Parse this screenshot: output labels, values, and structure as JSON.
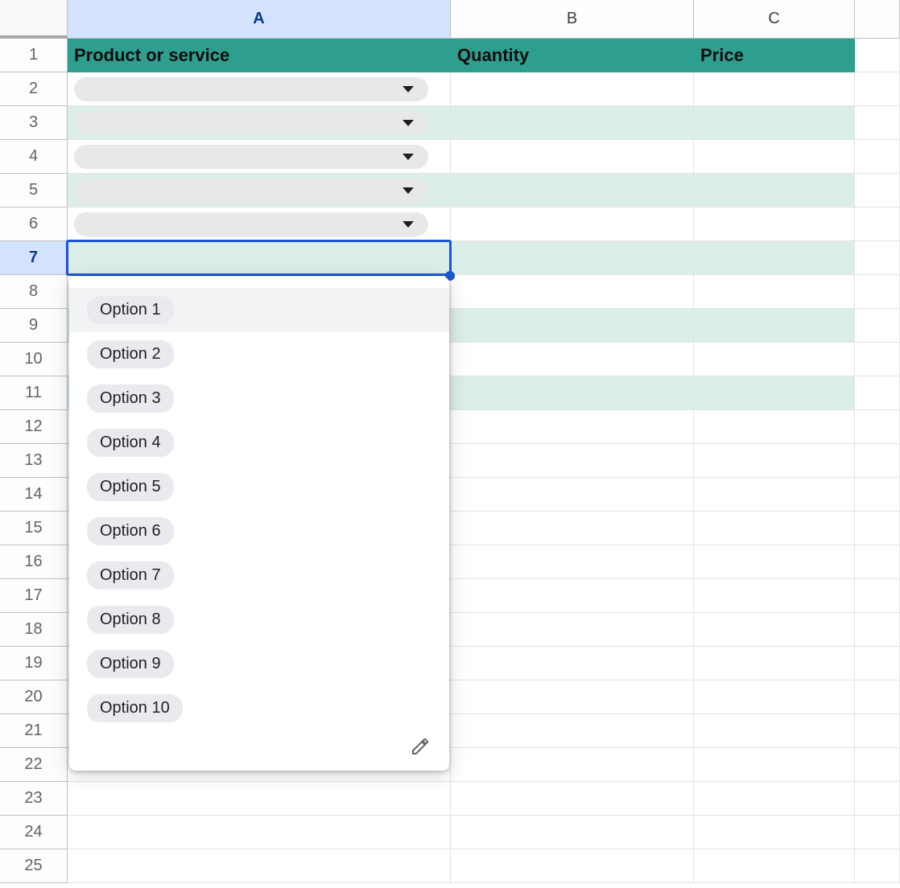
{
  "columns": {
    "a": "A",
    "b": "B",
    "c": "C"
  },
  "rows": [
    "1",
    "2",
    "3",
    "4",
    "5",
    "6",
    "7",
    "8",
    "9",
    "10",
    "11",
    "12",
    "13",
    "14",
    "15",
    "16",
    "17",
    "18",
    "19",
    "20",
    "21",
    "22",
    "23",
    "24",
    "25"
  ],
  "active_row_index": 6,
  "headers": {
    "product": "Product or service",
    "quantity": "Quantity",
    "price": "Price"
  },
  "active_cell": {
    "address": "A7",
    "value": ""
  },
  "dropdown": {
    "options": [
      "Option 1",
      "Option 2",
      "Option 3",
      "Option 4",
      "Option 5",
      "Option 6",
      "Option 7",
      "Option 8",
      "Option 9",
      "Option 10"
    ],
    "highlighted_index": 0
  },
  "colors": {
    "header_bg": "#2e9e8f",
    "banded_bg": "#dceee9",
    "selection_blue": "#1a56d6",
    "active_col_bg": "#d3e3fd"
  }
}
